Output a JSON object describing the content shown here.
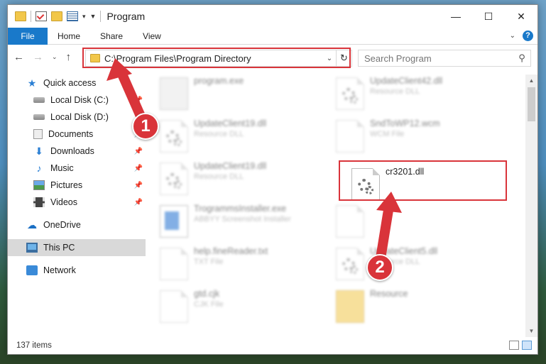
{
  "window": {
    "title": "Program"
  },
  "ribbon": {
    "tabs": [
      "File",
      "Home",
      "Share",
      "View"
    ]
  },
  "address": {
    "path": "C:\\Program Files\\Program Directory"
  },
  "search": {
    "placeholder": "Search Program"
  },
  "nav_pane": {
    "items": [
      {
        "label": "Quick access",
        "icon": "star-icon"
      },
      {
        "label": "Local Disk (C:)",
        "icon": "disk-icon",
        "pinned": true
      },
      {
        "label": "Local Disk (D:)",
        "icon": "disk-icon"
      },
      {
        "label": "Documents",
        "icon": "documents-icon",
        "pinned": true
      },
      {
        "label": "Downloads",
        "icon": "downloads-icon",
        "pinned": true
      },
      {
        "label": "Music",
        "icon": "music-icon",
        "pinned": true
      },
      {
        "label": "Pictures",
        "icon": "pictures-icon",
        "pinned": true
      },
      {
        "label": "Videos",
        "icon": "videos-icon",
        "pinned": true
      },
      {
        "label": "OneDrive",
        "icon": "onedrive-icon"
      },
      {
        "label": "This PC",
        "icon": "this-pc-icon",
        "selected": true
      },
      {
        "label": "Network",
        "icon": "network-icon"
      }
    ]
  },
  "files": [
    {
      "name": "program.exe",
      "type": "",
      "icon": "exe-icon"
    },
    {
      "name": "UpdateClient42.dll",
      "type": "Resource DLL",
      "icon": "dll-icon"
    },
    {
      "name": "UpdateClient19.dll",
      "type": "Resource DLL",
      "icon": "dll-icon"
    },
    {
      "name": "SndToWP12.wcm",
      "type": "WCM File",
      "icon": "file-icon"
    },
    {
      "name": "UpdateClient19.dll",
      "type": "Resource DLL",
      "icon": "dll-icon"
    },
    {
      "name": "cr3201.dll",
      "type": "",
      "icon": "dll-icon"
    },
    {
      "name": "TrogrammsInstaller.exe",
      "type": "ABBYY Screenshot Installer",
      "icon": "installer-icon"
    },
    {
      "name": "",
      "type": "",
      "icon": "file-icon"
    },
    {
      "name": "help.fineReader.txt",
      "type": "TXT File",
      "icon": "file-icon"
    },
    {
      "name": "UpdateClient5.dll",
      "type": "Resource DLL",
      "icon": "dll-icon"
    },
    {
      "name": "gtd.cjk",
      "type": "CJK File",
      "icon": "file-icon"
    },
    {
      "name": "Resource",
      "type": "",
      "icon": "folder-icon"
    }
  ],
  "status": {
    "items_count": "137 items"
  },
  "annotations": {
    "callout_1": "1",
    "callout_2": "2"
  },
  "colors": {
    "accent": "#1979ca",
    "highlight": "#d9343a"
  }
}
